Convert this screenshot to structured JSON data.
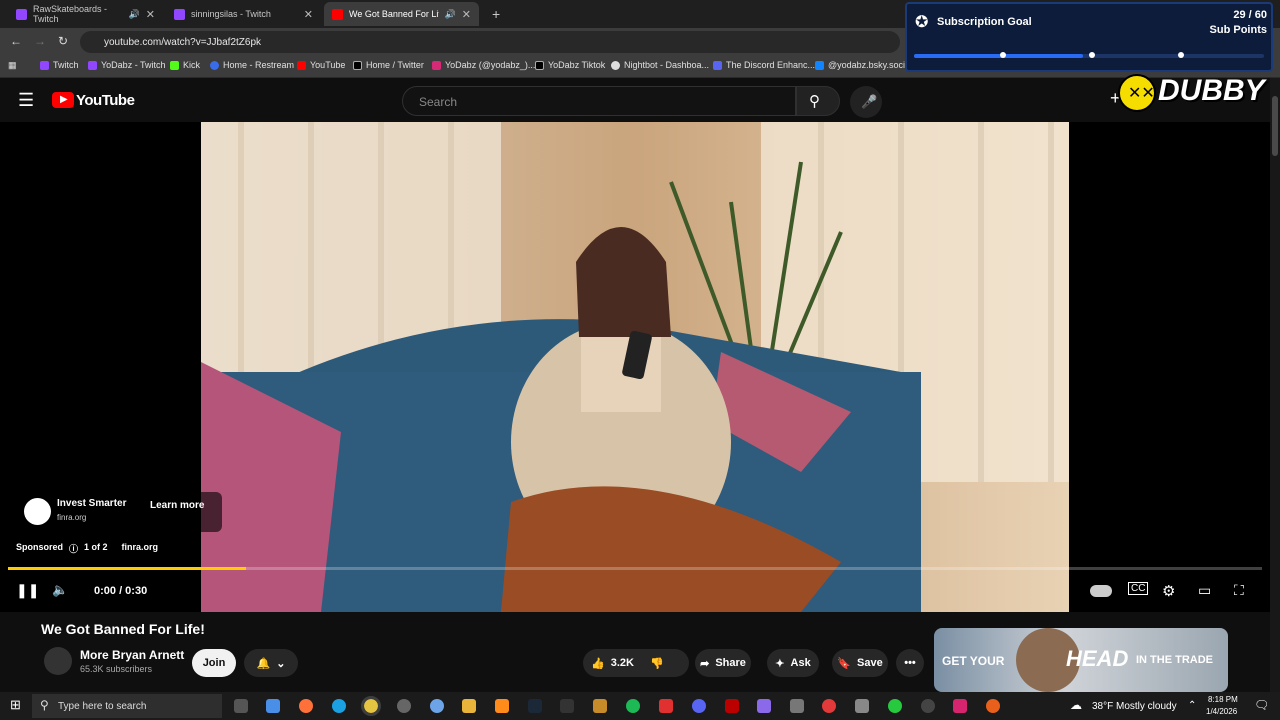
{
  "browser": {
    "tabs": [
      {
        "label": "RawSkateboards - Twitch",
        "icon": "twitch-icon"
      },
      {
        "label": "sinningsilas - Twitch",
        "icon": "twitch-icon"
      },
      {
        "label": "We Got Banned For Life! - Y",
        "icon": "youtube-icon"
      }
    ],
    "url": "youtube.com/watch?v=JJbaf2tZ6pk",
    "bookmarks": [
      "Twitch",
      "YoDabz - Twitch",
      "Kick",
      "Home - Restream",
      "YouTube",
      "Home / Twitter",
      "YoDabz (@yodabz_)...",
      "YoDabz Tiktok",
      "Nightbot - Dashboa...",
      "The Discord Enhanc...",
      "@yodabz.bsky.socia..."
    ]
  },
  "overlay": {
    "title": "Subscription Goal",
    "count": "29 / 60",
    "unit": "Sub Points",
    "progress": 0.483,
    "brand": "DUBBY"
  },
  "youtube": {
    "logo": "YouTube",
    "search_placeholder": "Search"
  },
  "player": {
    "ad_title": "Invest Smarter",
    "ad_domain": "finra.org",
    "learn_more": "Learn more",
    "sponsored": "Sponsored",
    "ad_count": "1 of 2",
    "ad_site": "finra.org",
    "time": "0:00 / 0:30",
    "progress": 0.19
  },
  "video": {
    "title": "We Got Banned For Life!",
    "channel": "More Bryan Arnett",
    "subscribers": "65.3K subscribers",
    "join": "Join",
    "likes": "3.2K",
    "share": "Share",
    "ask": "Ask",
    "save": "Save",
    "ad_banner_text_1": "GET YOUR",
    "ad_banner_text_2": "HEAD",
    "ad_banner_text_3": "IN THE TRADE"
  },
  "taskbar": {
    "search": "Type here to search",
    "weather": "38°F  Mostly cloudy",
    "time": "8:18 PM",
    "date": "1/4/2026"
  },
  "colors": {
    "accent": "#ff0000",
    "ad_progress": "#ffcc00",
    "goal_fill": "#2a6bf5"
  }
}
